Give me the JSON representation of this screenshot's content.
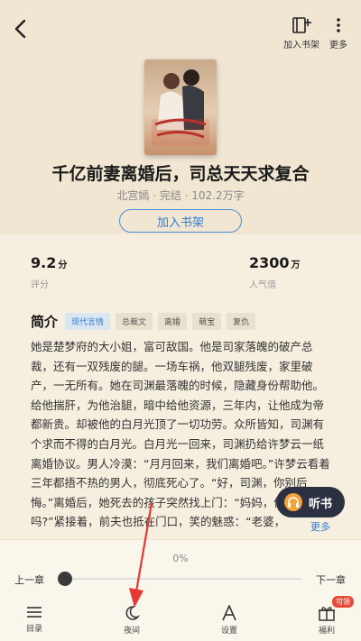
{
  "topbar": {
    "actions": [
      {
        "icon": "add-to-shelf-icon",
        "label": "加入书架"
      },
      {
        "icon": "more-icon",
        "label": "更多"
      }
    ]
  },
  "book": {
    "title": "千亿前妻离婚后，司总天天求复合",
    "meta": "北宫嫣 · 完结 · 102.2万字",
    "add_button": "加入书架"
  },
  "stats": {
    "rating": {
      "value": "9.2",
      "unit": "分",
      "label": "评分"
    },
    "popularity": {
      "value": "2300",
      "unit": "万",
      "label": "人气值"
    }
  },
  "intro": {
    "title": "简介",
    "tags": [
      "现代言情",
      "总裁文",
      "离婚",
      "萌宝",
      "复仇"
    ],
    "text": "她是楚梦府的大小姐，富可敌国。他是司家落魄的破产总裁，还有一双残废的腿。一场车祸，他双腿残废，家里破产，一无所有。她在司渊最落魄的时候，隐藏身份帮助他。给他揣肝，为他治腿，暗中给他资源，三年内，让他成为帝都新贵。却被他的白月光顶了一切功劳。众所皆知，司渊有个求而不得的白月光。白月光一回来，司渊扔给许梦云一纸离婚协议。男人冷漠：“月月回来，我们离婚吧。”许梦云看着三年都捂不热的男人，彻底死心了。“好，司渊，你别后悔。”离婚后，她死去的孩子突然找上门：“妈妈，你不要我了吗?”紧接着，前夫也抵在门口，笑的魅惑：“老婆，",
    "more": "更多"
  },
  "listen": {
    "label": "听书"
  },
  "reader": {
    "progress": "0%",
    "progress_value": 0,
    "prev": "上一章",
    "next": "下一章"
  },
  "nav": [
    {
      "icon": "toc-icon",
      "label": "目录"
    },
    {
      "icon": "moon-icon",
      "label": "夜间"
    },
    {
      "icon": "font-icon",
      "label": "设置"
    },
    {
      "icon": "gift-icon",
      "label": "福利",
      "badge": "可领"
    }
  ],
  "colors": {
    "background": "#f6efdf",
    "header": "#f0e6d2",
    "accent": "#2f7ed8",
    "listen_button": "#2c3142",
    "annotation_arrow": "#e53935",
    "badge": "#e84a3a"
  }
}
